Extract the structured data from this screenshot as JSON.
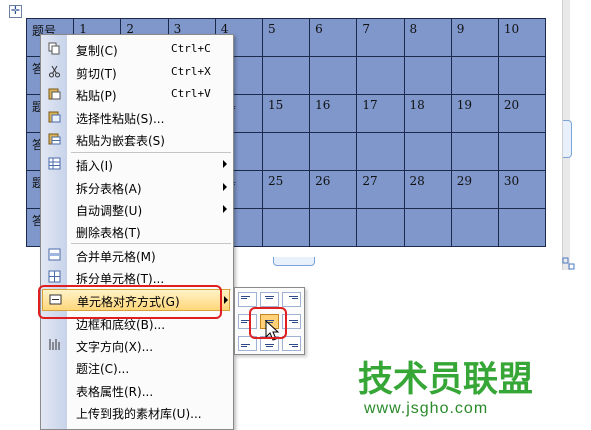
{
  "table": {
    "rows": [
      [
        "题号",
        "1",
        "2",
        "3",
        "4",
        "5",
        "6",
        "7",
        "8",
        "9",
        "10"
      ],
      [
        "答",
        "",
        "",
        "",
        "",
        "",
        "",
        "",
        "",
        "",
        ""
      ],
      [
        "题",
        "",
        "",
        "",
        "14",
        "15",
        "16",
        "17",
        "18",
        "19",
        "20"
      ],
      [
        "答",
        "",
        "",
        "",
        "",
        "",
        "",
        "",
        "",
        "",
        ""
      ],
      [
        "题",
        "",
        "",
        "",
        "24",
        "25",
        "26",
        "27",
        "28",
        "29",
        "30"
      ],
      [
        "答",
        "",
        "",
        "",
        "",
        "",
        "",
        "",
        "",
        "",
        ""
      ]
    ]
  },
  "menu": {
    "copy": {
      "label": "复制(C)",
      "shortcut": "Ctrl+C",
      "icon": "copy-icon"
    },
    "cut": {
      "label": "剪切(T)",
      "shortcut": "Ctrl+X",
      "icon": "scissors-icon"
    },
    "paste": {
      "label": "粘贴(P)",
      "shortcut": "Ctrl+V",
      "icon": "paste-icon"
    },
    "paste_special": {
      "label": "选择性粘贴(S)...",
      "icon": "paste-special-icon"
    },
    "paste_nested": {
      "label": "粘贴为嵌套表(S)",
      "icon": "paste-table-icon"
    },
    "insert": {
      "label": "插入(I)",
      "icon": "insert-table-icon"
    },
    "split_table": {
      "label": "拆分表格(A)"
    },
    "autofit": {
      "label": "自动调整(U)"
    },
    "delete_table": {
      "label": "删除表格(T)"
    },
    "merge_cells": {
      "label": "合并单元格(M)",
      "icon": "merge-cells-icon"
    },
    "split_cells": {
      "label": "拆分单元格(T)...",
      "icon": "split-cells-icon"
    },
    "cell_align": {
      "label": "单元格对齐方式(G)",
      "icon": "cell-align-icon"
    },
    "borders": {
      "label": "边框和底纹(B)..."
    },
    "text_direction": {
      "label": "文字方向(X)...",
      "icon": "text-direction-icon"
    },
    "caption": {
      "label": "题注(C)..."
    },
    "table_props": {
      "label": "表格属性(R)..."
    },
    "upload": {
      "label": "上传到我的素材库(U)..."
    }
  },
  "watermark": {
    "brand": "技术员联盟",
    "url": "www.jsgho.com"
  },
  "colors": {
    "table_fill": "#7f97cb",
    "highlight": "#ffd77a",
    "red_box": "#e02020",
    "brand_green": "#2a8a2a"
  }
}
